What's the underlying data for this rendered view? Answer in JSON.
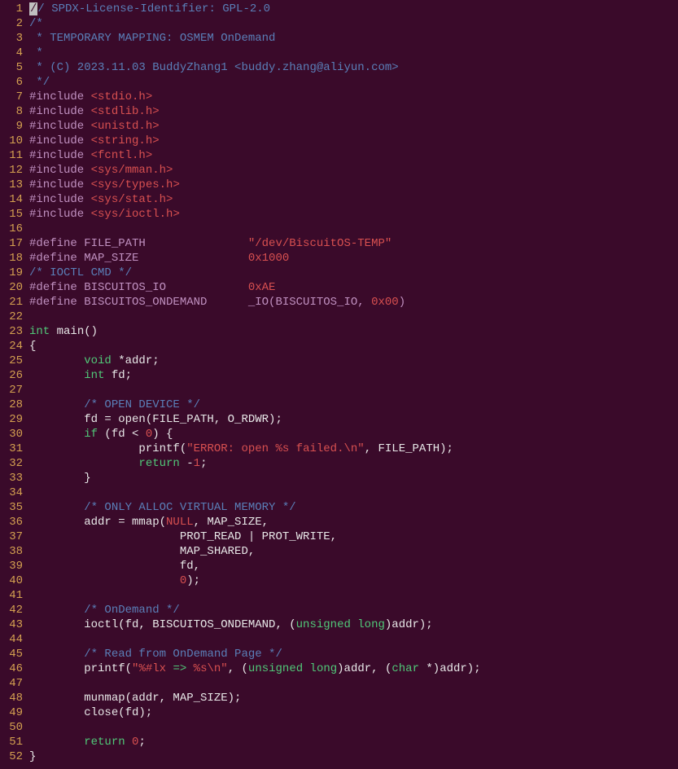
{
  "lines": [
    {
      "n": 1,
      "t": [
        {
          "c": "cursor",
          "s": "/"
        },
        {
          "c": "c-comment",
          "s": "/ SPDX-License-Identifier: GPL-2.0"
        }
      ]
    },
    {
      "n": 2,
      "t": [
        {
          "c": "c-comment",
          "s": "/*"
        }
      ]
    },
    {
      "n": 3,
      "t": [
        {
          "c": "c-comment",
          "s": " * TEMPORARY MAPPING: OSMEM OnDemand"
        }
      ]
    },
    {
      "n": 4,
      "t": [
        {
          "c": "c-comment",
          "s": " *"
        }
      ]
    },
    {
      "n": 5,
      "t": [
        {
          "c": "c-comment",
          "s": " * (C) 2023.11.03 BuddyZhang1 <buddy.zhang@aliyun.com>"
        }
      ]
    },
    {
      "n": 6,
      "t": [
        {
          "c": "c-comment",
          "s": " */"
        }
      ]
    },
    {
      "n": 7,
      "t": [
        {
          "c": "c-preproc",
          "s": "#include "
        },
        {
          "c": "c-include",
          "s": "<stdio.h>"
        }
      ]
    },
    {
      "n": 8,
      "t": [
        {
          "c": "c-preproc",
          "s": "#include "
        },
        {
          "c": "c-include",
          "s": "<stdlib.h>"
        }
      ]
    },
    {
      "n": 9,
      "t": [
        {
          "c": "c-preproc",
          "s": "#include "
        },
        {
          "c": "c-include",
          "s": "<unistd.h>"
        }
      ]
    },
    {
      "n": 10,
      "t": [
        {
          "c": "c-preproc",
          "s": "#include "
        },
        {
          "c": "c-include",
          "s": "<string.h>"
        }
      ]
    },
    {
      "n": 11,
      "t": [
        {
          "c": "c-preproc",
          "s": "#include "
        },
        {
          "c": "c-include",
          "s": "<fcntl.h>"
        }
      ]
    },
    {
      "n": 12,
      "t": [
        {
          "c": "c-preproc",
          "s": "#include "
        },
        {
          "c": "c-include",
          "s": "<sys/mman.h>"
        }
      ]
    },
    {
      "n": 13,
      "t": [
        {
          "c": "c-preproc",
          "s": "#include "
        },
        {
          "c": "c-include",
          "s": "<sys/types.h>"
        }
      ]
    },
    {
      "n": 14,
      "t": [
        {
          "c": "c-preproc",
          "s": "#include "
        },
        {
          "c": "c-include",
          "s": "<sys/stat.h>"
        }
      ]
    },
    {
      "n": 15,
      "t": [
        {
          "c": "c-preproc",
          "s": "#include "
        },
        {
          "c": "c-include",
          "s": "<sys/ioctl.h>"
        }
      ]
    },
    {
      "n": 16,
      "t": [
        {
          "c": "c-default",
          "s": ""
        }
      ]
    },
    {
      "n": 17,
      "t": [
        {
          "c": "c-preproc",
          "s": "#define FILE_PATH               "
        },
        {
          "c": "c-string",
          "s": "\"/dev/BiscuitOS-TEMP\""
        }
      ]
    },
    {
      "n": 18,
      "t": [
        {
          "c": "c-preproc",
          "s": "#define MAP_SIZE                "
        },
        {
          "c": "c-number",
          "s": "0x1000"
        }
      ]
    },
    {
      "n": 19,
      "t": [
        {
          "c": "c-comment",
          "s": "/* IOCTL CMD */"
        }
      ]
    },
    {
      "n": 20,
      "t": [
        {
          "c": "c-preproc",
          "s": "#define BISCUITOS_IO            "
        },
        {
          "c": "c-number",
          "s": "0xAE"
        }
      ]
    },
    {
      "n": 21,
      "t": [
        {
          "c": "c-preproc",
          "s": "#define BISCUITOS_ONDEMAND      _IO(BISCUITOS_IO, "
        },
        {
          "c": "c-number",
          "s": "0x00"
        },
        {
          "c": "c-preproc",
          "s": ")"
        }
      ]
    },
    {
      "n": 22,
      "t": [
        {
          "c": "c-default",
          "s": ""
        }
      ]
    },
    {
      "n": 23,
      "t": [
        {
          "c": "c-type",
          "s": "int"
        },
        {
          "c": "c-default",
          "s": " main()"
        }
      ]
    },
    {
      "n": 24,
      "t": [
        {
          "c": "c-default",
          "s": "{"
        }
      ]
    },
    {
      "n": 25,
      "t": [
        {
          "c": "c-default",
          "s": "        "
        },
        {
          "c": "c-type",
          "s": "void"
        },
        {
          "c": "c-default",
          "s": " *addr;"
        }
      ]
    },
    {
      "n": 26,
      "t": [
        {
          "c": "c-default",
          "s": "        "
        },
        {
          "c": "c-type",
          "s": "int"
        },
        {
          "c": "c-default",
          "s": " fd;"
        }
      ]
    },
    {
      "n": 27,
      "t": [
        {
          "c": "c-default",
          "s": ""
        }
      ]
    },
    {
      "n": 28,
      "t": [
        {
          "c": "c-default",
          "s": "        "
        },
        {
          "c": "c-comment",
          "s": "/* OPEN DEVICE */"
        }
      ]
    },
    {
      "n": 29,
      "t": [
        {
          "c": "c-default",
          "s": "        fd = open(FILE_PATH, O_RDWR);"
        }
      ]
    },
    {
      "n": 30,
      "t": [
        {
          "c": "c-default",
          "s": "        "
        },
        {
          "c": "c-keyword",
          "s": "if"
        },
        {
          "c": "c-default",
          "s": " (fd < "
        },
        {
          "c": "c-number",
          "s": "0"
        },
        {
          "c": "c-default",
          "s": ") {"
        }
      ]
    },
    {
      "n": 31,
      "t": [
        {
          "c": "c-default",
          "s": "                printf("
        },
        {
          "c": "c-string",
          "s": "\"ERROR: open "
        },
        {
          "c": "c-number",
          "s": "%s"
        },
        {
          "c": "c-string",
          "s": " failed."
        },
        {
          "c": "c-number",
          "s": "\\n"
        },
        {
          "c": "c-string",
          "s": "\""
        },
        {
          "c": "c-default",
          "s": ", FILE_PATH);"
        }
      ]
    },
    {
      "n": 32,
      "t": [
        {
          "c": "c-default",
          "s": "                "
        },
        {
          "c": "c-keyword",
          "s": "return"
        },
        {
          "c": "c-default",
          "s": " -"
        },
        {
          "c": "c-number",
          "s": "1"
        },
        {
          "c": "c-default",
          "s": ";"
        }
      ]
    },
    {
      "n": 33,
      "t": [
        {
          "c": "c-default",
          "s": "        }"
        }
      ]
    },
    {
      "n": 34,
      "t": [
        {
          "c": "c-default",
          "s": ""
        }
      ]
    },
    {
      "n": 35,
      "t": [
        {
          "c": "c-default",
          "s": "        "
        },
        {
          "c": "c-comment",
          "s": "/* ONLY ALLOC VIRTUAL MEMORY */"
        }
      ]
    },
    {
      "n": 36,
      "t": [
        {
          "c": "c-default",
          "s": "        addr = mmap("
        },
        {
          "c": "c-number",
          "s": "NULL"
        },
        {
          "c": "c-default",
          "s": ", MAP_SIZE,"
        }
      ]
    },
    {
      "n": 37,
      "t": [
        {
          "c": "c-default",
          "s": "                      PROT_READ | PROT_WRITE,"
        }
      ]
    },
    {
      "n": 38,
      "t": [
        {
          "c": "c-default",
          "s": "                      MAP_SHARED,"
        }
      ]
    },
    {
      "n": 39,
      "t": [
        {
          "c": "c-default",
          "s": "                      fd,"
        }
      ]
    },
    {
      "n": 40,
      "t": [
        {
          "c": "c-default",
          "s": "                      "
        },
        {
          "c": "c-number",
          "s": "0"
        },
        {
          "c": "c-default",
          "s": ");"
        }
      ]
    },
    {
      "n": 41,
      "t": [
        {
          "c": "c-default",
          "s": ""
        }
      ]
    },
    {
      "n": 42,
      "t": [
        {
          "c": "c-default",
          "s": "        "
        },
        {
          "c": "c-comment",
          "s": "/* OnDemand */"
        }
      ]
    },
    {
      "n": 43,
      "t": [
        {
          "c": "c-default",
          "s": "        ioctl(fd, BISCUITOS_ONDEMAND, ("
        },
        {
          "c": "c-type",
          "s": "unsigned"
        },
        {
          "c": "c-default",
          "s": " "
        },
        {
          "c": "c-type",
          "s": "long"
        },
        {
          "c": "c-default",
          "s": ")addr);"
        }
      ]
    },
    {
      "n": 44,
      "t": [
        {
          "c": "c-default",
          "s": ""
        }
      ]
    },
    {
      "n": 45,
      "t": [
        {
          "c": "c-default",
          "s": "        "
        },
        {
          "c": "c-comment",
          "s": "/* Read from OnDemand Page */"
        }
      ]
    },
    {
      "n": 46,
      "t": [
        {
          "c": "c-default",
          "s": "        printf("
        },
        {
          "c": "c-string",
          "s": "\""
        },
        {
          "c": "c-number",
          "s": "%#lx"
        },
        {
          "c": "c-string",
          "s": " "
        },
        {
          "c": "c-keyword",
          "s": "=>"
        },
        {
          "c": "c-string",
          "s": " "
        },
        {
          "c": "c-number",
          "s": "%s"
        },
        {
          "c": "c-number",
          "s": "\\n"
        },
        {
          "c": "c-string",
          "s": "\""
        },
        {
          "c": "c-default",
          "s": ", ("
        },
        {
          "c": "c-type",
          "s": "unsigned"
        },
        {
          "c": "c-default",
          "s": " "
        },
        {
          "c": "c-type",
          "s": "long"
        },
        {
          "c": "c-default",
          "s": ")addr, ("
        },
        {
          "c": "c-type",
          "s": "char"
        },
        {
          "c": "c-default",
          "s": " *)addr);"
        }
      ]
    },
    {
      "n": 47,
      "t": [
        {
          "c": "c-default",
          "s": ""
        }
      ]
    },
    {
      "n": 48,
      "t": [
        {
          "c": "c-default",
          "s": "        munmap(addr, MAP_SIZE);"
        }
      ]
    },
    {
      "n": 49,
      "t": [
        {
          "c": "c-default",
          "s": "        close(fd);"
        }
      ]
    },
    {
      "n": 50,
      "t": [
        {
          "c": "c-default",
          "s": ""
        }
      ]
    },
    {
      "n": 51,
      "t": [
        {
          "c": "c-default",
          "s": "        "
        },
        {
          "c": "c-keyword",
          "s": "return"
        },
        {
          "c": "c-default",
          "s": " "
        },
        {
          "c": "c-number",
          "s": "0"
        },
        {
          "c": "c-default",
          "s": ";"
        }
      ]
    },
    {
      "n": 52,
      "t": [
        {
          "c": "c-default",
          "s": "}"
        }
      ]
    }
  ]
}
